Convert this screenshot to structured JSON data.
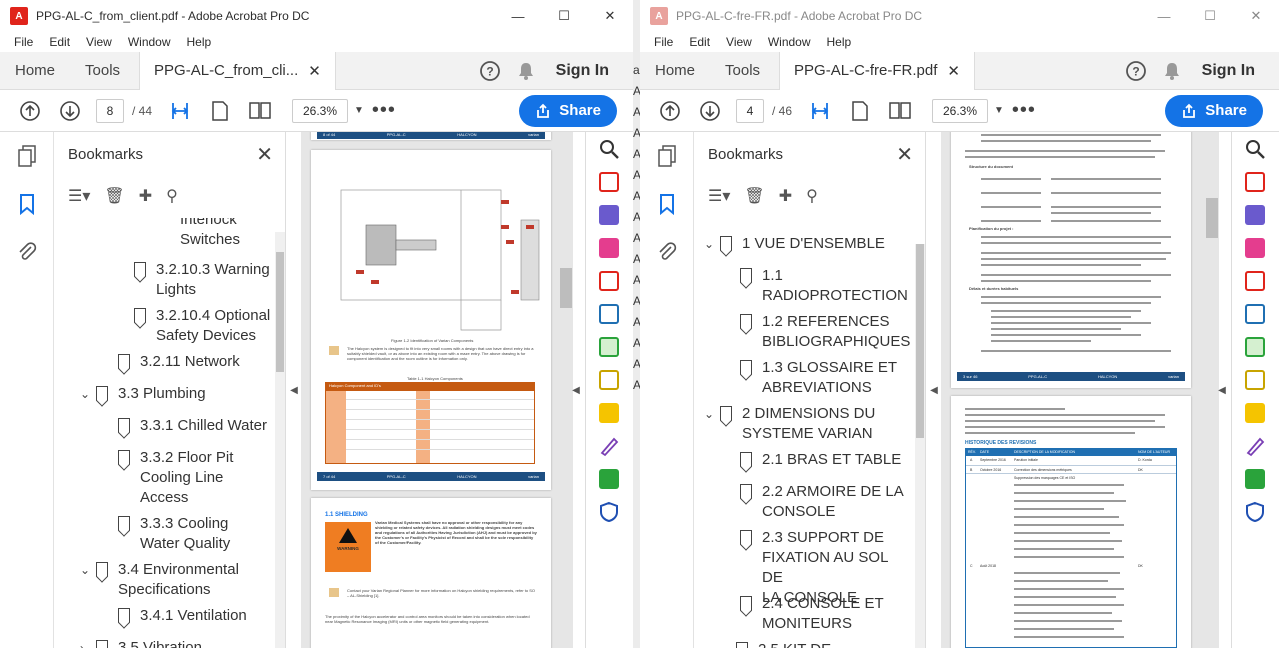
{
  "left": {
    "title": "PPG-AL-C_from_client.pdf - Adobe Acrobat Pro DC",
    "menu": [
      "File",
      "Edit",
      "View",
      "Window",
      "Help"
    ],
    "tabs": {
      "home": "Home",
      "tools": "Tools",
      "doc": "PPG-AL-C_from_cli..."
    },
    "sign_in": "Sign In",
    "page_current": "8",
    "page_total": "/ 44",
    "zoom": "26.3%",
    "share": "Share",
    "bookmarks_title": "Bookmarks",
    "bookmarks": [
      {
        "lines": [
          "Interlock",
          "Switches"
        ]
      },
      {
        "lines": [
          "3.2.10.3 Warning",
          "Lights"
        ]
      },
      {
        "lines": [
          "3.2.10.4 Optional",
          "Safety Devices"
        ]
      },
      {
        "lines": [
          "3.2.11 Network"
        ]
      },
      {
        "lines": [
          "3.3 Plumbing"
        ]
      },
      {
        "lines": [
          "3.3.1 Chilled Water"
        ]
      },
      {
        "lines": [
          "3.3.2 Floor Pit",
          "Cooling Line",
          "Access"
        ]
      },
      {
        "lines": [
          "3.3.3  Cooling",
          "Water Quality"
        ]
      },
      {
        "lines": [
          "3.4 Environmental",
          "Specifications"
        ]
      },
      {
        "lines": [
          "3.4.1 Ventilation"
        ]
      },
      {
        "lines": [
          "3.5 Vibration"
        ]
      }
    ],
    "page_text": {
      "header_left": "8 of 44",
      "header_mid": "PPG-AL-C",
      "header_brand": "HALCYON",
      "header_logo": "varian",
      "figure_caption": "Figure 1-2 Identification of Varian Components",
      "body1": "The Halcyon system is designed to fit into very small rooms with a design that can have direct entry into a suitably shielded vault, or as above into an existing room with a maze entry. The above drawing is for component identification and the room outline is for information only.",
      "table_caption": "Table 1-1 Halcyon Components",
      "table_header": "Halcyon Component and ID's",
      "footer_left": "7 of 44",
      "section": "1.1 SHIELDING",
      "warning": "WARNING",
      "warning_text": "Varian Medical Systems shall have no approval or other responsibility for any shielding or related safety devices. All radiation shielding designs must meet codes and regulations of all Authorities Having Jurisdiction (AHJ) and must be approved by the Customer's or Facility's Physicist of Record and shall be the sole responsibility of the Customer/Facility.",
      "note_text": "Contact your Varian Regional Planner for more information on Halcyon shielding requirements, refer to SO – AL-Shielding [1].",
      "body2": "The proximity of the Halcyon accelerator and control area monitors should be taken into consideration when located near Magnetic Resonance Imaging (MRI) units or other magnetic field generating equipment."
    }
  },
  "right": {
    "title": "PPG-AL-C-fre-FR.pdf - Adobe Acrobat Pro DC",
    "menu": [
      "File",
      "Edit",
      "View",
      "Window",
      "Help"
    ],
    "tabs": {
      "home": "Home",
      "tools": "Tools",
      "doc": "PPG-AL-C-fre-FR.pdf"
    },
    "sign_in": "Sign In",
    "page_current": "4",
    "page_total": "/ 46",
    "zoom": "26.3%",
    "share": "Share",
    "bookmarks_title": "Bookmarks",
    "bookmarks": [
      {
        "lines": [
          "1 VUE D'ENSEMBLE"
        ]
      },
      {
        "lines": [
          "1.1",
          "RADIOPROTECTION"
        ]
      },
      {
        "lines": [
          "1.2 REFERENCES",
          "BIBLIOGRAPHIQUES"
        ]
      },
      {
        "lines": [
          "1.3 GLOSSAIRE ET",
          "ABREVIATIONS"
        ]
      },
      {
        "lines": [
          "2 DIMENSIONS DU",
          "SYSTEME VARIAN"
        ]
      },
      {
        "lines": [
          "2.1 BRAS ET TABLE"
        ]
      },
      {
        "lines": [
          "2.2 ARMOIRE DE LA",
          "CONSOLE"
        ]
      },
      {
        "lines": [
          "2.3 SUPPORT DE",
          "FIXATION AU SOL DE",
          "LA CONSOLE"
        ]
      },
      {
        "lines": [
          "2.4 CONSOLE ET",
          "MONITEURS"
        ]
      },
      {
        "lines": [
          "2.5 KIT DE"
        ]
      }
    ],
    "page_text": {
      "footer_left": "3 sur 46",
      "footer_mid": "PPG-AL-C",
      "footer_brand": "HALCYON",
      "footer_logo": "varian",
      "sub1": "Structure du document",
      "sub2": "Planification du projet :",
      "sub3": "Délais et durées habituels",
      "rev_title": "HISTORIQUE DES REVISIONS",
      "rev_head": [
        "RÉV.",
        "DATE",
        "DESCRIPTION DE LA MODIFICATION",
        "NOM DE L'AUTEUR"
      ],
      "rev_rows": [
        {
          "rev": "A",
          "date": "Septembre 2016",
          "desc": "Parution initiale",
          "author": "D. Korda"
        },
        {
          "rev": "B",
          "date": "Octobre 2016",
          "desc": "Correction des dimensions métriques",
          "author": "DK"
        },
        {
          "rev": "C",
          "date": "Août 2018",
          "desc": "Suppression des marquages CE et ISO",
          "author": "DK"
        }
      ]
    }
  },
  "background_strip": [
    "an",
    "AL",
    "AL",
    "AL",
    "AL",
    "AL",
    "AL",
    "AL",
    "AL",
    "AL",
    "AL",
    "AL",
    "AL",
    "AL",
    "AL",
    "AL"
  ]
}
